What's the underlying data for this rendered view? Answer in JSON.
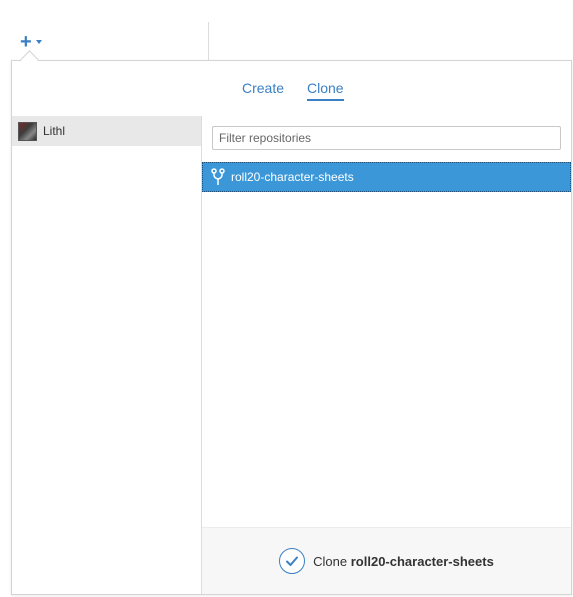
{
  "toolbar": {
    "add_icon": "plus-icon",
    "dropdown_icon": "caret-down-icon"
  },
  "tabs": [
    {
      "label": "Create",
      "active": false
    },
    {
      "label": "Clone",
      "active": true
    }
  ],
  "sidebar": {
    "items": [
      {
        "label": "Lithl",
        "icon": "avatar",
        "selected": true
      }
    ]
  },
  "filter": {
    "placeholder": "Filter repositories",
    "value": ""
  },
  "repositories": [
    {
      "name": "roll20-character-sheets",
      "icon": "fork-icon",
      "selected": true
    }
  ],
  "footer": {
    "action_prefix": "Clone",
    "action_target": "roll20-character-sheets",
    "icon": "checkmark-icon"
  },
  "colors": {
    "accent": "#3b7fc4",
    "selection": "#3b97d8",
    "sidebar_selected": "#e8e8e8"
  }
}
